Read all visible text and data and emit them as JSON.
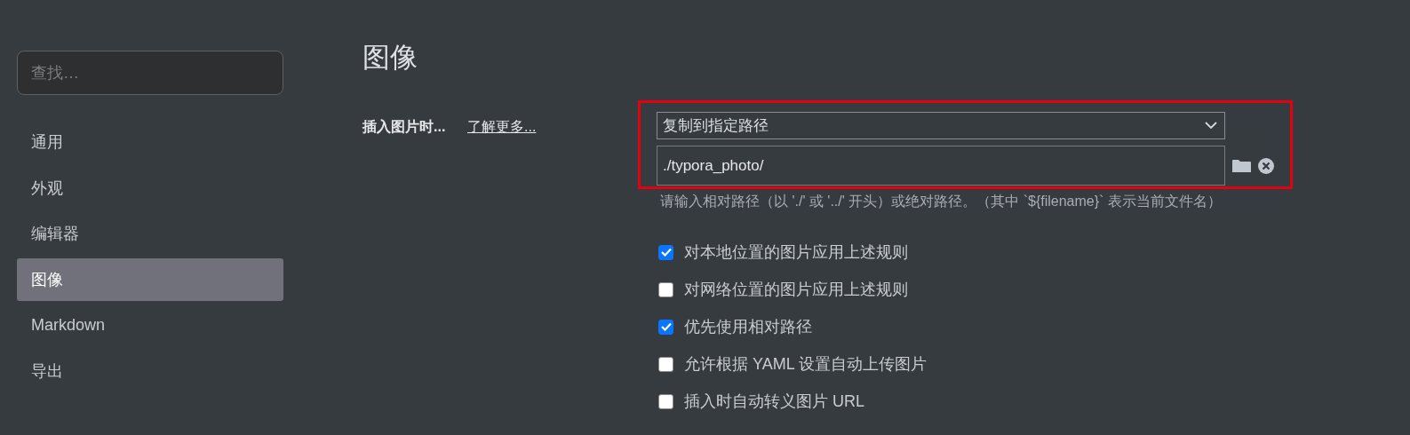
{
  "sidebar": {
    "search": {
      "placeholder": "查找…"
    },
    "items": [
      {
        "label": "通用",
        "selected": false
      },
      {
        "label": "外观",
        "selected": false
      },
      {
        "label": "编辑器",
        "selected": false
      },
      {
        "label": "图像",
        "selected": true
      },
      {
        "label": "Markdown",
        "selected": false
      },
      {
        "label": "导出",
        "selected": false
      }
    ]
  },
  "page": {
    "title": "图像",
    "setting": {
      "label": "插入图片时...",
      "link": "了解更多...",
      "select": {
        "value": "复制到指定路径"
      },
      "path_field": {
        "value": "./typora_photo/"
      },
      "hint": "请输入相对路径（以 './' 或 '../' 开头）或绝对路径。（其中 `${filename}` 表示当前文件名）"
    },
    "options": [
      {
        "label": "对本地位置的图片应用上述规则",
        "checked": true
      },
      {
        "label": "对网络位置的图片应用上述规则",
        "checked": false
      },
      {
        "label": "优先使用相对路径",
        "checked": true
      },
      {
        "label": "允许根据 YAML 设置自动上传图片",
        "checked": false
      },
      {
        "label": "插入时自动转义图片 URL",
        "checked": false
      }
    ]
  }
}
